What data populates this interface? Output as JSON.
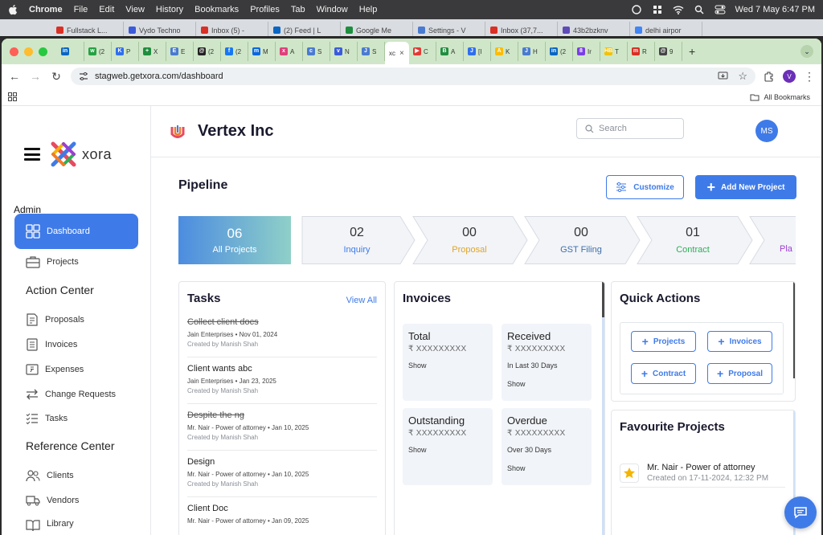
{
  "menubar": {
    "app": "Chrome",
    "items": [
      "File",
      "Edit",
      "View",
      "History",
      "Bookmarks",
      "Profiles",
      "Tab",
      "Window",
      "Help"
    ],
    "datetime": "Wed 7 May  6:47 PM"
  },
  "back_tabs": [
    {
      "label": "Fullstack L...",
      "color": "#d93025"
    },
    {
      "label": "Vydo Techno",
      "color": "#3b5bdb"
    },
    {
      "label": "Inbox (5) -",
      "color": "#d93025"
    },
    {
      "label": "(2) Feed | L",
      "color": "#0a66c2"
    },
    {
      "label": "Google Me",
      "color": "#1e8e3e"
    },
    {
      "label": "Settings - V",
      "color": "#4a7bd0"
    },
    {
      "label": "Inbox (37,7...",
      "color": "#d93025"
    },
    {
      "label": "43b2bzknv",
      "color": "#5f4bb6"
    },
    {
      "label": "delhi airpor",
      "color": "#4285f4"
    }
  ],
  "front_tabs": [
    {
      "label": "",
      "color": "#0a66c2",
      "glyph": "in"
    },
    {
      "label": "(2",
      "color": "#25a244",
      "glyph": "w"
    },
    {
      "label": "P",
      "color": "#2f6fed",
      "glyph": "K"
    },
    {
      "label": "X",
      "color": "#1e8e3e",
      "glyph": "+"
    },
    {
      "label": "E",
      "color": "#4a7bd0",
      "glyph": "E"
    },
    {
      "label": "(2",
      "color": "#222222",
      "glyph": "@"
    },
    {
      "label": "(2",
      "color": "#1877f2",
      "glyph": "f"
    },
    {
      "label": "M",
      "color": "#0668e1",
      "glyph": "m"
    },
    {
      "label": "A",
      "color": "#e0407b",
      "glyph": "x"
    },
    {
      "label": "S",
      "color": "#4a7bd0",
      "glyph": "c"
    },
    {
      "label": "N",
      "color": "#3b5bdb",
      "glyph": "v"
    },
    {
      "label": "S",
      "color": "#4a7bd0",
      "glyph": "J"
    },
    {
      "label": "xc",
      "color": "#ffffff",
      "glyph": ""
    },
    {
      "label": "C",
      "color": "#e53935",
      "glyph": "▶"
    },
    {
      "label": "A",
      "color": "#1e8e3e",
      "glyph": "B"
    },
    {
      "label": "[I",
      "color": "#2f6fed",
      "glyph": "J"
    },
    {
      "label": "K",
      "color": "#fbbc04",
      "glyph": "A"
    },
    {
      "label": "H",
      "color": "#4a7bd0",
      "glyph": "J"
    },
    {
      "label": "(2",
      "color": "#0a66c2",
      "glyph": "in"
    },
    {
      "label": "Ir",
      "color": "#7b3fe4",
      "glyph": "8"
    },
    {
      "label": "T",
      "color": "#f2c200",
      "glyph": "HB"
    },
    {
      "label": "R",
      "color": "#d93025",
      "glyph": "m"
    },
    {
      "label": "9",
      "color": "#444444",
      "glyph": "@"
    }
  ],
  "browser": {
    "url": "stagweb.getxora.com/dashboard",
    "profile_initial": "V",
    "all_bookmarks": "All Bookmarks"
  },
  "sidebar": {
    "logo_text": "xora",
    "admin_label": "Admin",
    "items": [
      {
        "label": "Dashboard",
        "icon": "dashboard-icon"
      },
      {
        "label": "Projects",
        "icon": "briefcase-icon"
      }
    ],
    "action_center_title": "Action Center",
    "action_items": [
      {
        "label": "Proposals",
        "icon": "proposal-icon"
      },
      {
        "label": "Invoices",
        "icon": "invoice-icon"
      },
      {
        "label": "Expenses",
        "icon": "expense-icon"
      },
      {
        "label": "Change Requests",
        "icon": "swap-icon"
      },
      {
        "label": "Tasks",
        "icon": "tasks-icon"
      }
    ],
    "reference_center_title": "Reference Center",
    "reference_items": [
      {
        "label": "Clients",
        "icon": "clients-icon"
      },
      {
        "label": "Vendors",
        "icon": "truck-icon"
      },
      {
        "label": "Library",
        "icon": "library-icon"
      }
    ]
  },
  "header": {
    "company": "Vertex Inc",
    "search_placeholder": "Search",
    "avatar_initials": "MS"
  },
  "pipeline": {
    "title": "Pipeline",
    "customize_label": "Customize",
    "add_label": "Add New Project",
    "all": {
      "count": "06",
      "label": "All Projects"
    },
    "stages": [
      {
        "count": "02",
        "label": "Inquiry",
        "color": "#3f7be8"
      },
      {
        "count": "00",
        "label": "Proposal",
        "color": "#e0a526"
      },
      {
        "count": "00",
        "label": "GST Filing",
        "color": "#3f6fa8"
      },
      {
        "count": "01",
        "label": "Contract",
        "color": "#2fae56"
      },
      {
        "count": "",
        "label": "Pla",
        "color": "#9c3fd0"
      }
    ]
  },
  "tasks": {
    "title": "Tasks",
    "view_all": "View All",
    "items": [
      {
        "title": "Collect client docs",
        "meta": "Jain Enterprises • Nov 01, 2024",
        "created": "Created by Manish Shah",
        "done": true
      },
      {
        "title": "Client wants abc",
        "meta": "Jain Enterprises • Jan 23, 2025",
        "created": "Created by Manish Shah",
        "done": false
      },
      {
        "title": "Despite the ng",
        "meta": "Mr. Nair - Power of attorney • Jan 10, 2025",
        "created": "Created by Manish Shah",
        "done": true
      },
      {
        "title": "Design",
        "meta": "Mr. Nair - Power of attorney • Jan 10, 2025",
        "created": "Created by Manish Shah",
        "done": false
      },
      {
        "title": "Client Doc",
        "meta": "Mr. Nair - Power of attorney • Jan 09, 2025",
        "created": "",
        "done": false
      }
    ]
  },
  "invoices": {
    "title": "Invoices",
    "boxes": [
      {
        "heading": "Total",
        "amount": "₹ XXXXXXXXX",
        "line1": "Show",
        "line2": ""
      },
      {
        "heading": "Received",
        "amount": "₹ XXXXXXXXX",
        "line1": "In Last 30 Days",
        "line2": "Show"
      },
      {
        "heading": "Outstanding",
        "amount": "₹ XXXXXXXXX",
        "line1": "Show",
        "line2": ""
      },
      {
        "heading": "Overdue",
        "amount": "₹ XXXXXXXXX",
        "line1": "Over 30 Days",
        "line2": "Show"
      }
    ]
  },
  "quick_actions": {
    "title": "Quick Actions",
    "buttons": [
      "Projects",
      "Invoices",
      "Contract",
      "Proposal"
    ]
  },
  "favourites": {
    "title": "Favourite Projects",
    "items": [
      {
        "name": "Mr. Nair - Power of attorney",
        "created": "Created on 17-11-2024, 12:32 PM"
      }
    ]
  },
  "colors": {
    "accent": "#3f7be8",
    "star": "#f4b400"
  }
}
